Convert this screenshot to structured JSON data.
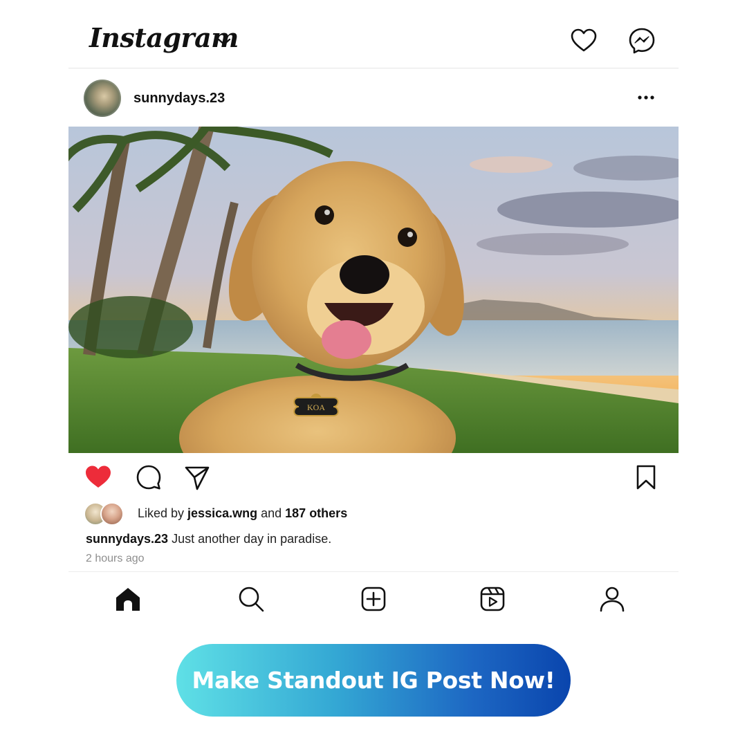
{
  "app": {
    "logo_text": "Instagram",
    "icons": [
      "chevron-down-icon",
      "heart-icon",
      "messenger-icon"
    ]
  },
  "post": {
    "username": "sunnydays.23",
    "more_icon": "more-dots-icon",
    "photo": {
      "tag_text": "KOA"
    },
    "actions": {
      "liked": true,
      "like_color": "#ed2c3a",
      "icons": [
        "heart-filled-icon",
        "comment-icon",
        "share-icon",
        "bookmark-icon"
      ]
    },
    "likes": {
      "prefix": "Liked by ",
      "user": "jessica.wng",
      "middle": " and ",
      "count_text": "187 others"
    },
    "caption": {
      "username": "sunnydays.23",
      "text": " Just another day in paradise."
    },
    "timestamp": "2 hours ago"
  },
  "bottom_nav": {
    "items": [
      {
        "name": "home",
        "icon": "home-icon",
        "active": true
      },
      {
        "name": "search",
        "icon": "search-icon",
        "active": false
      },
      {
        "name": "create",
        "icon": "plus-square-icon",
        "active": false
      },
      {
        "name": "reels",
        "icon": "reels-icon",
        "active": false
      },
      {
        "name": "profile",
        "icon": "profile-icon",
        "active": false
      }
    ]
  },
  "cta": {
    "label": "Make Standout IG Post Now!",
    "gradient_start": "#5fe0e6",
    "gradient_end": "#0a45ad"
  }
}
